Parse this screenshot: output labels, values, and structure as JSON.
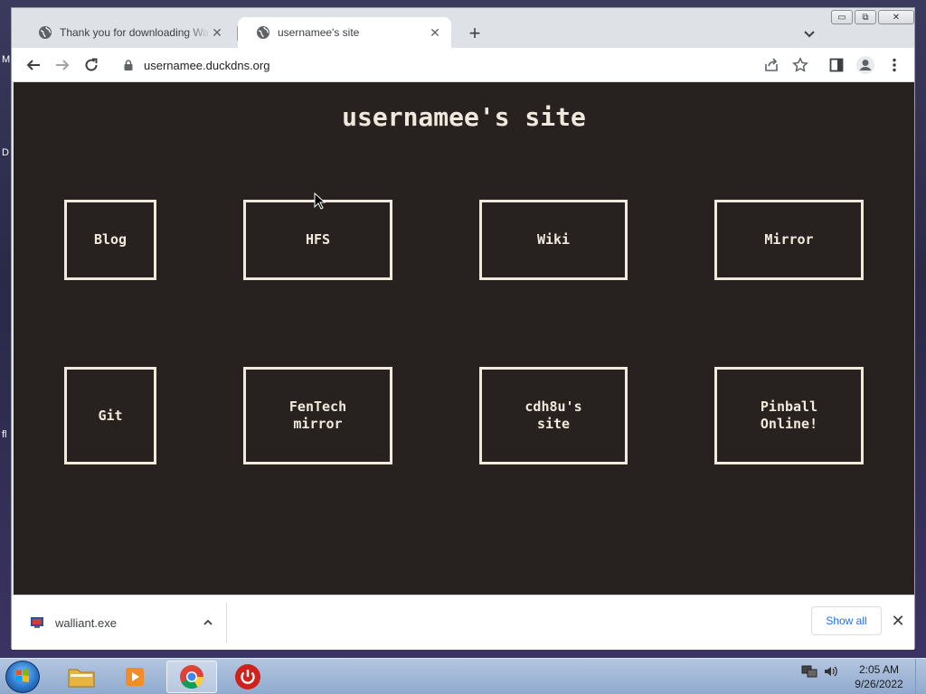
{
  "browser": {
    "tabs": [
      {
        "title": "Thank you for downloading Walliant",
        "close": "✕"
      },
      {
        "title": "usernamee's site",
        "close": "✕"
      }
    ],
    "new_tab_label": "+",
    "address": "usernamee.duckdns.org",
    "window_controls": {
      "minimize": "▭",
      "maximize": "⧉",
      "close": "✕"
    }
  },
  "page": {
    "title": "usernamee's site",
    "links": [
      "Blog",
      "HFS",
      "Wiki",
      "Mirror",
      "Git",
      "FenTech\nmirror",
      "cdh8u's\nsite",
      "Pinball\nOnline!"
    ],
    "colors": {
      "background": "#27221f",
      "foreground": "#f0eadd"
    }
  },
  "downloads": {
    "file": "walliant.exe",
    "show_all": "Show all",
    "close": "✕"
  },
  "taskbar": {
    "time": "2:05 AM",
    "date": "9/26/2022",
    "apps": [
      "file-explorer-icon",
      "media-player-icon",
      "chrome-icon",
      "power-icon"
    ]
  },
  "desktop_fragments": [
    "M",
    "D",
    "fl"
  ]
}
